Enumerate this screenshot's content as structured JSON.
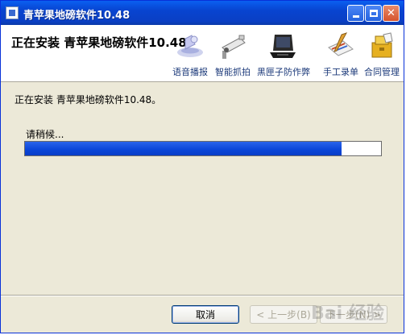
{
  "window": {
    "title": "青苹果地磅软件10.48",
    "controls": {
      "minimize": "minimize-icon",
      "maximize": "maximize-icon",
      "close": "close-icon"
    }
  },
  "header": {
    "title": "正在安装 青苹果地磅软件10.48",
    "features": [
      {
        "label": "语音播报",
        "icon": "voice-broadcast-icon"
      },
      {
        "label": "智能抓拍",
        "icon": "camera-icon"
      },
      {
        "label": "黑匣子防作弊",
        "icon": "black-box-icon"
      },
      {
        "label": "手工录单",
        "icon": "manual-entry-icon"
      },
      {
        "label": "合同管理",
        "icon": "contract-icon"
      }
    ]
  },
  "main": {
    "status": "正在安装 青苹果地磅软件10.48。",
    "wait_label": "请稍候...",
    "progress": 0.89
  },
  "buttons": {
    "cancel": "取消",
    "back": "< 上一步(B)",
    "next": "下一步(N) >"
  },
  "watermark": "Bai 经验"
}
